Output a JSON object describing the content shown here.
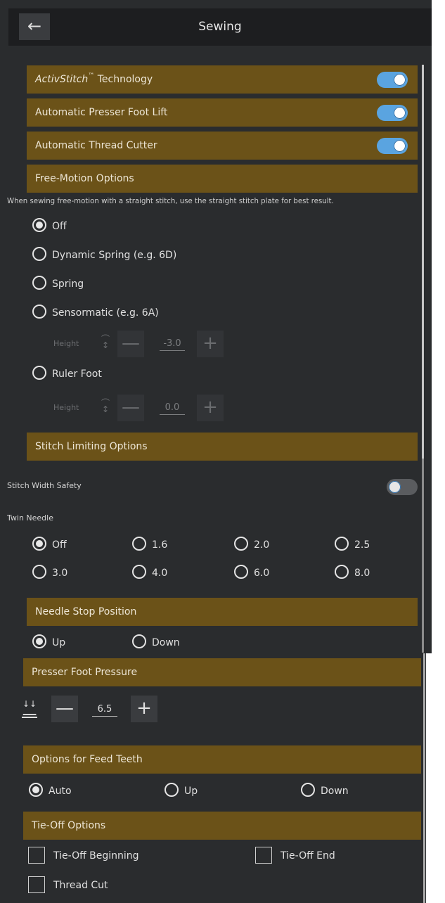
{
  "header": {
    "title": "Sewing",
    "back_icon": "arrow-left-icon"
  },
  "toggles": [
    {
      "label_main": "ActivStitch",
      "label_tm": "™",
      "label_rest": " Technology",
      "on": true
    },
    {
      "label": "Automatic Presser Foot Lift",
      "on": true
    },
    {
      "label": "Automatic Thread Cutter",
      "on": true
    }
  ],
  "free_motion": {
    "title": "Free-Motion Options",
    "note": "When sewing free-motion with a straight stitch, use the straight stitch plate for best result.",
    "options": [
      "Off",
      "Dynamic Spring (e.g. 6D)",
      "Spring",
      "Sensormatic (e.g. 6A)",
      "Ruler Foot"
    ],
    "selected": "Off",
    "height_label": "Height",
    "sensormatic_height": "-3.0",
    "ruler_height": "0.0"
  },
  "stitch_limiting": {
    "title": "Stitch Limiting Options",
    "width_safety_label": "Stitch Width Safety",
    "width_safety_on": false,
    "twin_needle_label": "Twin Needle",
    "twin_options": [
      "Off",
      "1.6",
      "2.0",
      "2.5",
      "3.0",
      "4.0",
      "6.0",
      "8.0"
    ],
    "twin_selected": "Off"
  },
  "needle_stop": {
    "title": "Needle Stop Position",
    "options": [
      "Up",
      "Down"
    ],
    "selected": "Up"
  },
  "presser_foot": {
    "title": "Presser Foot Pressure",
    "value": "6.5",
    "minus": "—",
    "plus": "+"
  },
  "feed_teeth": {
    "title": "Options for Feed Teeth",
    "options": [
      "Auto",
      "Up",
      "Down"
    ],
    "selected": "Auto"
  },
  "tie_off": {
    "title": "Tie-Off Options",
    "options": [
      "Tie-Off Beginning",
      "Tie-Off End",
      "Thread Cut"
    ]
  },
  "colors": {
    "section": "#6b5218",
    "toggle_on": "#5aa4e0",
    "background": "#2a2c2e"
  }
}
